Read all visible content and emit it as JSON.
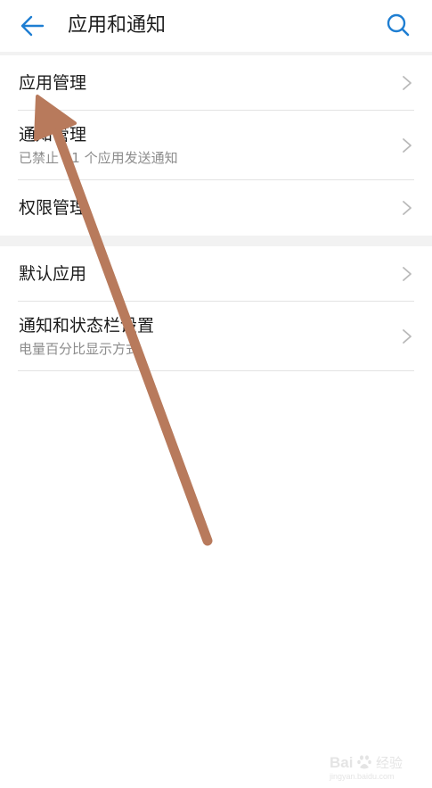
{
  "header": {
    "title": "应用和通知",
    "back_icon": "back-arrow-icon",
    "search_icon": "search-icon",
    "accent_color": "#1e7ed2"
  },
  "section1": {
    "items": [
      {
        "label": "应用管理",
        "subtitle": ""
      },
      {
        "label": "通知管理",
        "subtitle": "已禁止 21 个应用发送通知"
      },
      {
        "label": "权限管理",
        "subtitle": ""
      }
    ]
  },
  "section2": {
    "items": [
      {
        "label": "默认应用",
        "subtitle": ""
      },
      {
        "label": "通知和状态栏设置",
        "subtitle": "电量百分比显示方式"
      }
    ]
  },
  "annotation": {
    "arrow_color": "#b87a5c",
    "icon": "pointer-arrow-annotation"
  },
  "watermark": {
    "text": "Baidu 经验",
    "subtext": "jingyan.baidu.com"
  }
}
